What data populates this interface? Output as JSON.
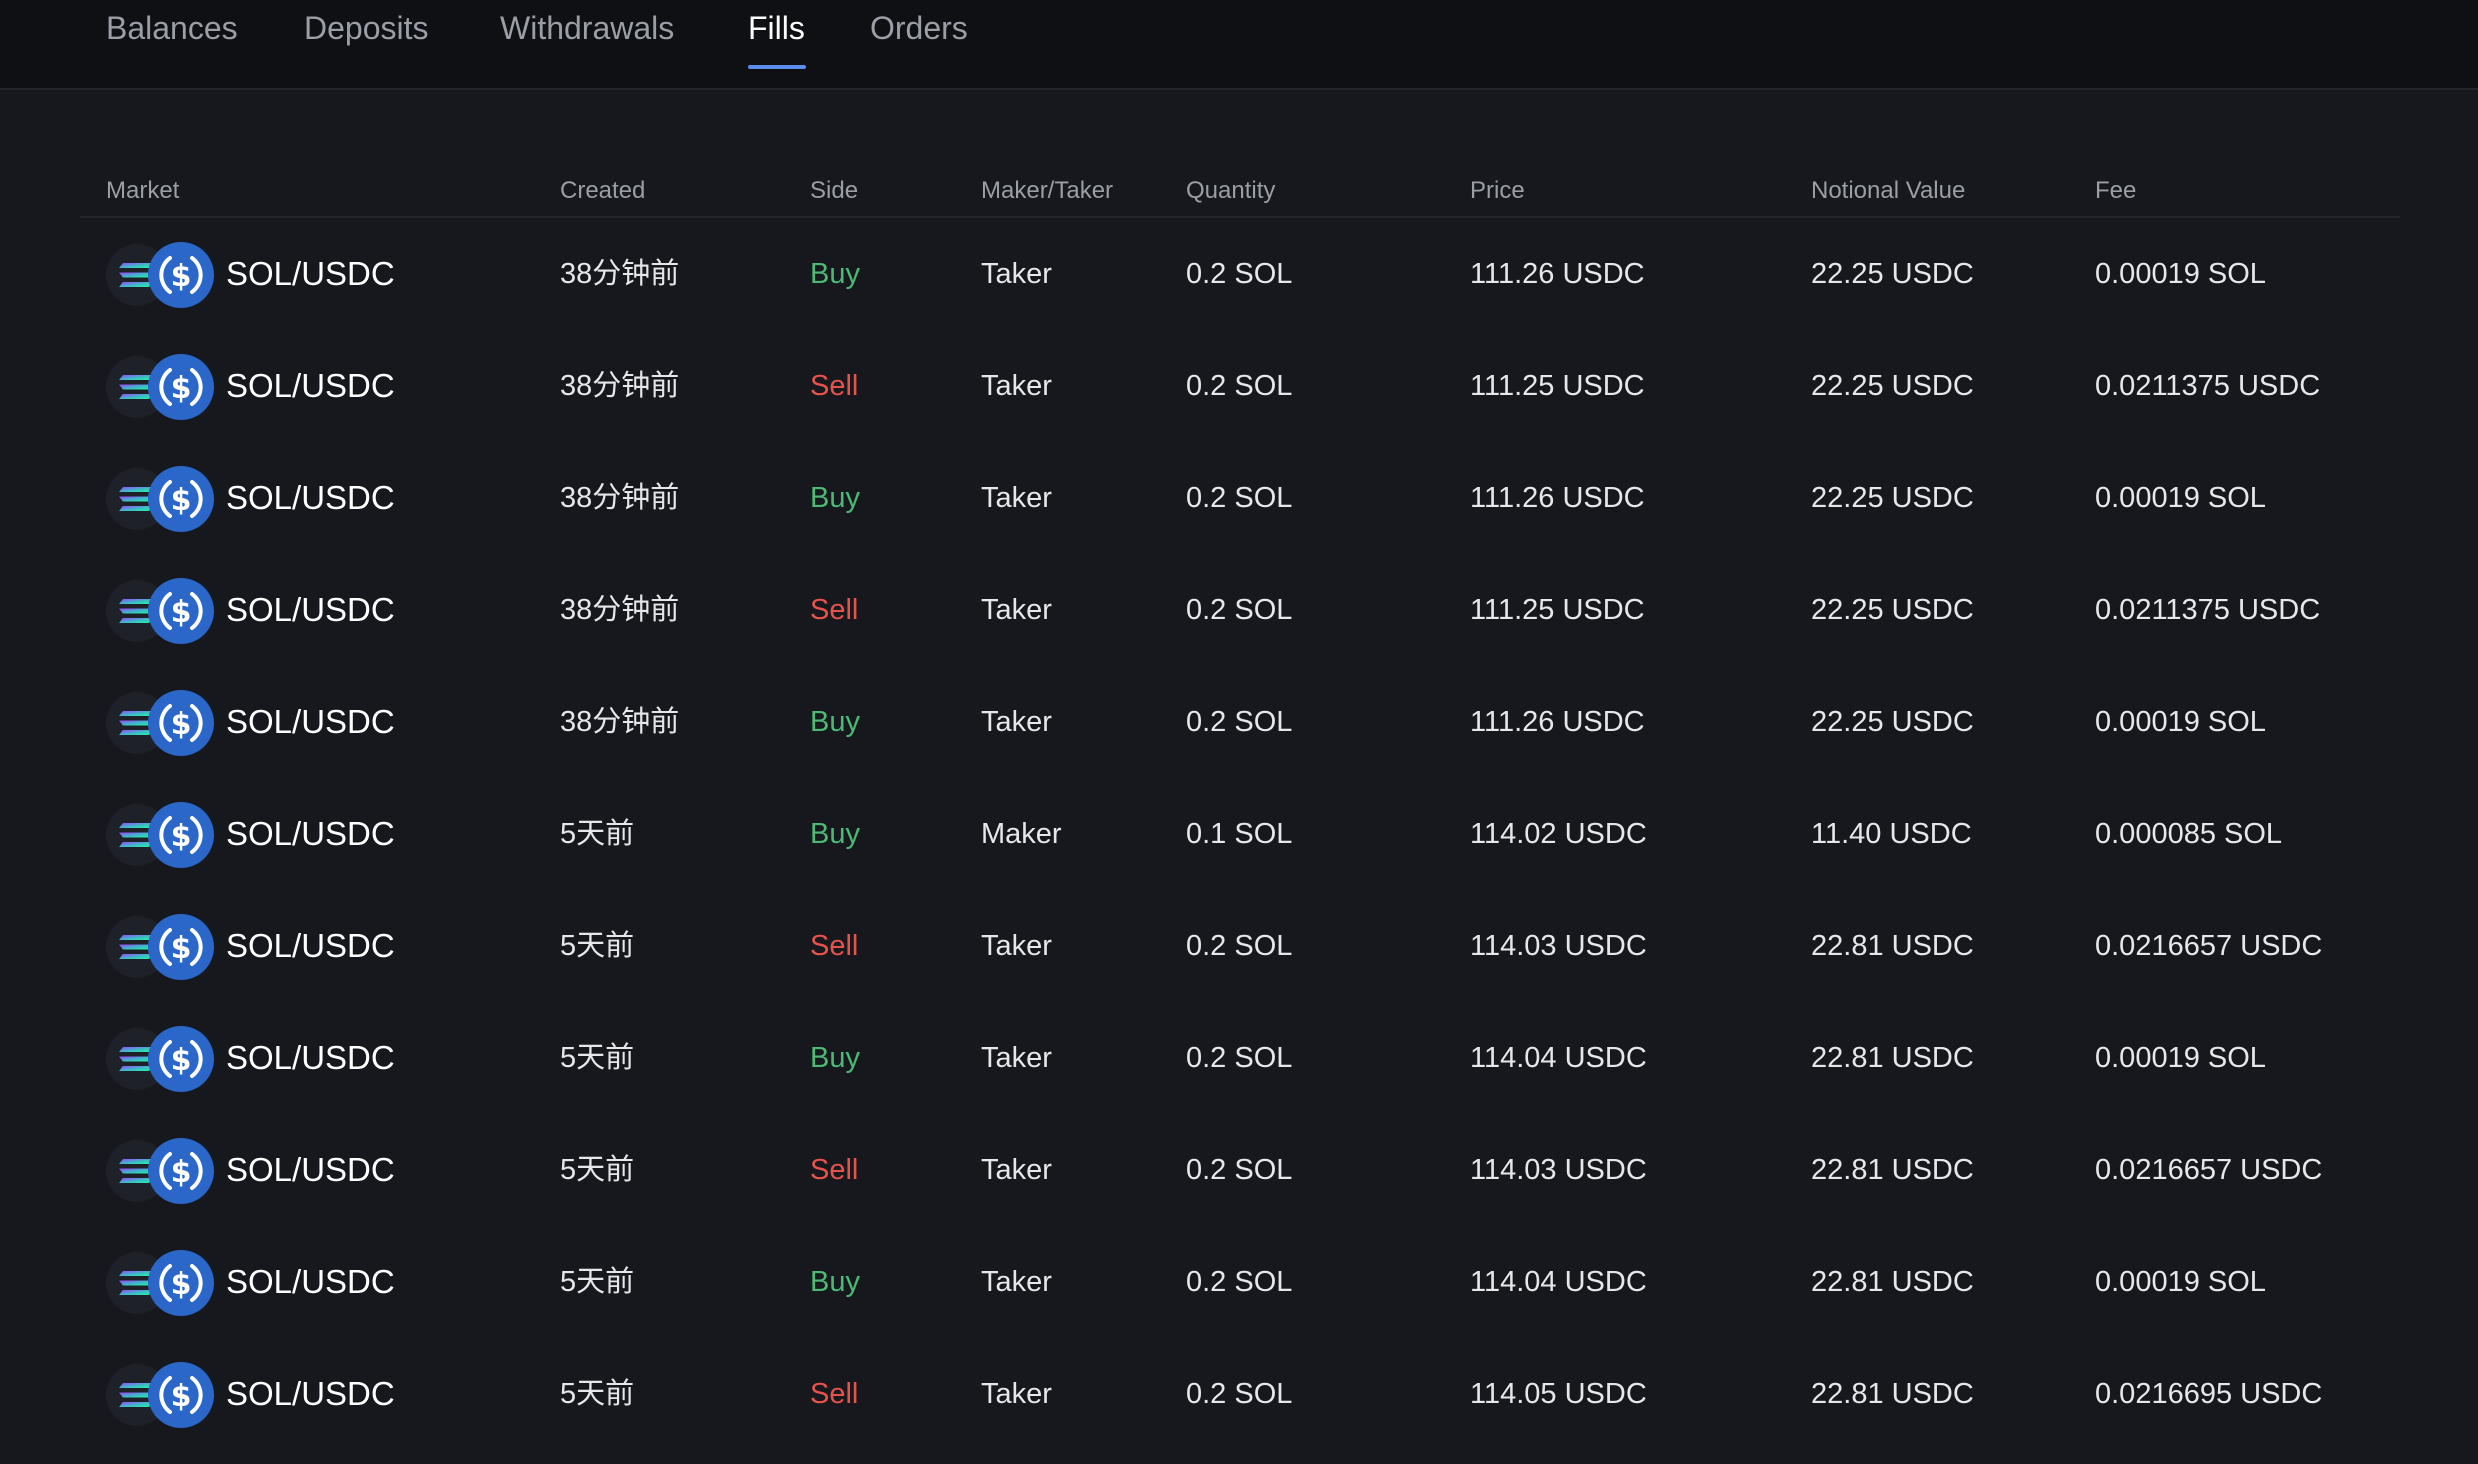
{
  "tabs": [
    {
      "label": "Balances",
      "active": false
    },
    {
      "label": "Deposits",
      "active": false
    },
    {
      "label": "Withdrawals",
      "active": false
    },
    {
      "label": "Fills",
      "active": true
    },
    {
      "label": "Orders",
      "active": false
    }
  ],
  "colors": {
    "accent": "#5b8def",
    "buy": "#4eb974",
    "sell": "#e5534b",
    "background": "#16181d",
    "header_background": "#0f1014"
  },
  "icons": {
    "base_token": "solana-icon",
    "quote_token": "usdc-icon"
  },
  "table": {
    "columns": [
      "Market",
      "Created",
      "Side",
      "Maker/Taker",
      "Quantity",
      "Price",
      "Notional Value",
      "Fee"
    ],
    "rows": [
      {
        "market": "SOL/USDC",
        "created": "38分钟前",
        "side": "Buy",
        "role": "Taker",
        "quantity": "0.2 SOL",
        "price": "111.26 USDC",
        "notional": "22.25 USDC",
        "fee": "0.00019 SOL"
      },
      {
        "market": "SOL/USDC",
        "created": "38分钟前",
        "side": "Sell",
        "role": "Taker",
        "quantity": "0.2 SOL",
        "price": "111.25 USDC",
        "notional": "22.25 USDC",
        "fee": "0.0211375 USDC"
      },
      {
        "market": "SOL/USDC",
        "created": "38分钟前",
        "side": "Buy",
        "role": "Taker",
        "quantity": "0.2 SOL",
        "price": "111.26 USDC",
        "notional": "22.25 USDC",
        "fee": "0.00019 SOL"
      },
      {
        "market": "SOL/USDC",
        "created": "38分钟前",
        "side": "Sell",
        "role": "Taker",
        "quantity": "0.2 SOL",
        "price": "111.25 USDC",
        "notional": "22.25 USDC",
        "fee": "0.0211375 USDC"
      },
      {
        "market": "SOL/USDC",
        "created": "38分钟前",
        "side": "Buy",
        "role": "Taker",
        "quantity": "0.2 SOL",
        "price": "111.26 USDC",
        "notional": "22.25 USDC",
        "fee": "0.00019 SOL"
      },
      {
        "market": "SOL/USDC",
        "created": "5天前",
        "side": "Buy",
        "role": "Maker",
        "quantity": "0.1 SOL",
        "price": "114.02 USDC",
        "notional": "11.40 USDC",
        "fee": "0.000085 SOL"
      },
      {
        "market": "SOL/USDC",
        "created": "5天前",
        "side": "Sell",
        "role": "Taker",
        "quantity": "0.2 SOL",
        "price": "114.03 USDC",
        "notional": "22.81 USDC",
        "fee": "0.0216657 USDC"
      },
      {
        "market": "SOL/USDC",
        "created": "5天前",
        "side": "Buy",
        "role": "Taker",
        "quantity": "0.2 SOL",
        "price": "114.04 USDC",
        "notional": "22.81 USDC",
        "fee": "0.00019 SOL"
      },
      {
        "market": "SOL/USDC",
        "created": "5天前",
        "side": "Sell",
        "role": "Taker",
        "quantity": "0.2 SOL",
        "price": "114.03 USDC",
        "notional": "22.81 USDC",
        "fee": "0.0216657 USDC"
      },
      {
        "market": "SOL/USDC",
        "created": "5天前",
        "side": "Buy",
        "role": "Taker",
        "quantity": "0.2 SOL",
        "price": "114.04 USDC",
        "notional": "22.81 USDC",
        "fee": "0.00019 SOL"
      },
      {
        "market": "SOL/USDC",
        "created": "5天前",
        "side": "Sell",
        "role": "Taker",
        "quantity": "0.2 SOL",
        "price": "114.05 USDC",
        "notional": "22.81 USDC",
        "fee": "0.0216695 USDC"
      }
    ]
  }
}
